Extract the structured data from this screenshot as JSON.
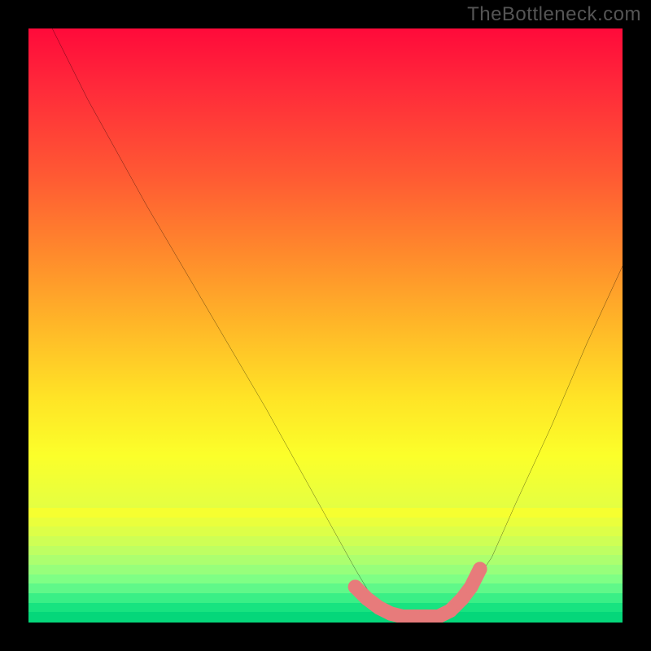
{
  "watermark": "TheBottleneck.com",
  "colors": {
    "black": "#000000",
    "curve": "#000000",
    "marker": "#e77b7b",
    "watermark": "#555555"
  },
  "chart_data": {
    "type": "line",
    "title": "",
    "xlabel": "",
    "ylabel": "",
    "xlim": [
      0,
      100
    ],
    "ylim": [
      0,
      100
    ],
    "grid": false,
    "legend": false,
    "series": [
      {
        "name": "bottleneck-curve",
        "x": [
          4,
          10,
          20,
          30,
          40,
          50,
          55,
          58,
          60,
          63,
          66,
          70,
          74,
          78,
          82,
          88,
          94,
          100
        ],
        "y": [
          100,
          88,
          70,
          53,
          36,
          18,
          9,
          4,
          2,
          1,
          1,
          2,
          5,
          11,
          20,
          33,
          47,
          60
        ]
      },
      {
        "name": "sweet-spot-markers",
        "x": [
          55,
          57,
          59,
          61,
          63,
          65,
          67,
          69,
          71,
          73,
          74.5,
          76
        ],
        "y": [
          6,
          4,
          2.5,
          1.5,
          1,
          1,
          1,
          1,
          2,
          4,
          6,
          9
        ]
      }
    ],
    "gradient_stops": [
      {
        "pos": 0,
        "color": "#ff0a3a"
      },
      {
        "pos": 10,
        "color": "#ff2a3a"
      },
      {
        "pos": 25,
        "color": "#ff5a33"
      },
      {
        "pos": 38,
        "color": "#ff8a2c"
      },
      {
        "pos": 50,
        "color": "#ffb728"
      },
      {
        "pos": 62,
        "color": "#ffe326"
      },
      {
        "pos": 72,
        "color": "#fbff2a"
      },
      {
        "pos": 80,
        "color": "#e6ff40"
      },
      {
        "pos": 85,
        "color": "#c8ff55"
      },
      {
        "pos": 90,
        "color": "#9cff6b"
      },
      {
        "pos": 95,
        "color": "#5cff84"
      },
      {
        "pos": 100,
        "color": "#05e07a"
      }
    ],
    "bottom_bands": [
      "#f6ff30",
      "#eaff3c",
      "#ddff48",
      "#ceff55",
      "#beff62",
      "#acff6f",
      "#97ff7b",
      "#7fff85",
      "#60f889",
      "#3aef86",
      "#18e380",
      "#05d77a"
    ]
  }
}
